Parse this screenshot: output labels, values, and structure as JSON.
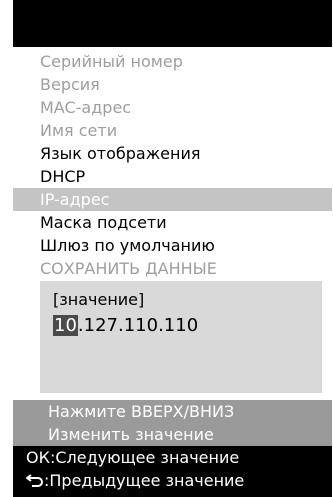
{
  "menu": {
    "items": [
      {
        "label": "Серийный номер"
      },
      {
        "label": "Версия"
      },
      {
        "label": "MAC-адрес"
      },
      {
        "label": "Имя сети"
      },
      {
        "label": "Язык отображения"
      },
      {
        "label": "DHCP"
      },
      {
        "label": "IP-адрес"
      },
      {
        "label": "Маска подсети"
      },
      {
        "label": "Шлюз по умолчанию"
      },
      {
        "label": "СОХРАНИТЬ ДАННЫЕ"
      }
    ],
    "selected": "IP-адрес"
  },
  "editor": {
    "label": "[значение]",
    "value_cursor": "10",
    "value_rest": ".127.110.110"
  },
  "help": {
    "line1": "Нажмите ВВЕРХ/ВНИЗ",
    "line2": "Изменить значение"
  },
  "keys": {
    "ok": "ОК:Следующее значение",
    "back": ":Предыдущее значение",
    "back_icon": "return-arrow-icon"
  }
}
